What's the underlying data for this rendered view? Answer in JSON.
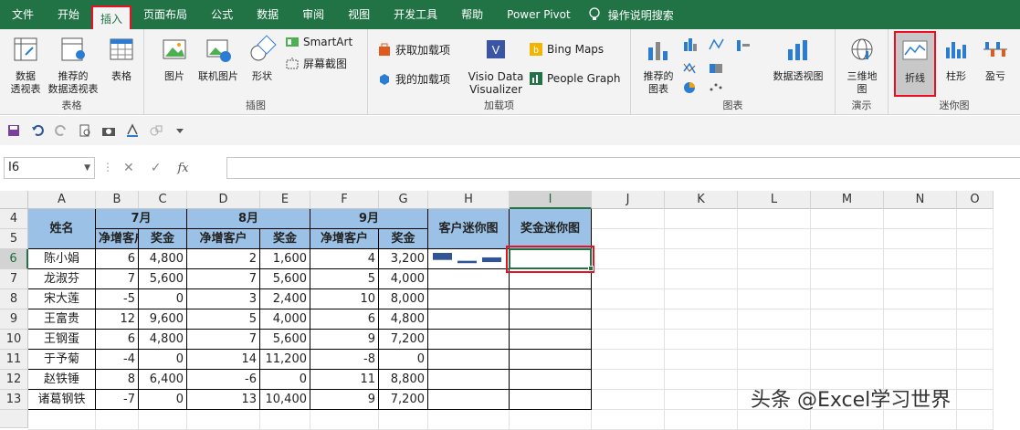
{
  "tabs": [
    {
      "label": "文件",
      "active": false
    },
    {
      "label": "开始",
      "active": false
    },
    {
      "label": "插入",
      "active": true
    },
    {
      "label": "页面布局",
      "active": false
    },
    {
      "label": "公式",
      "active": false
    },
    {
      "label": "数据",
      "active": false
    },
    {
      "label": "审阅",
      "active": false
    },
    {
      "label": "视图",
      "active": false
    },
    {
      "label": "开发工具",
      "active": false
    },
    {
      "label": "帮助",
      "active": false
    },
    {
      "label": "Power Pivot",
      "active": false
    }
  ],
  "tell_me": "操作说明搜索",
  "ribbon": {
    "tables": {
      "label": "表格",
      "pivot": "数据\n透视表",
      "recommended_pivot": "推荐的\n数据透视表",
      "table": "表格"
    },
    "illustrations": {
      "label": "插图",
      "pictures": "图片",
      "online_pictures": "联机图片",
      "shapes": "形状",
      "smartart": "SmartArt",
      "screenshot": "屏幕截图"
    },
    "addins": {
      "label": "加载项",
      "get_addins": "获取加载项",
      "my_addins": "我的加载项",
      "visio": "Visio Data\nVisualizer",
      "bing_maps": "Bing Maps",
      "people_graph": "People Graph"
    },
    "charts": {
      "label": "图表",
      "recommended": "推荐的\n图表",
      "pivot_chart": "数据透视图"
    },
    "tours": {
      "label": "演示",
      "map3d": "三维地\n图"
    },
    "sparklines": {
      "label": "迷你图",
      "line": "折线",
      "column": "柱形",
      "winloss": "盈亏"
    }
  },
  "namebox": "I6",
  "columns": [
    "A",
    "B",
    "C",
    "D",
    "E",
    "F",
    "G",
    "H",
    "I",
    "J",
    "K",
    "L",
    "M",
    "N",
    "O"
  ],
  "selected_column": "I",
  "rows": [
    "4",
    "5",
    "6",
    "7",
    "8",
    "9",
    "10",
    "11",
    "12",
    "13"
  ],
  "selected_row": "6",
  "header": {
    "name": "姓名",
    "jul": "7月",
    "aug": "8月",
    "sep": "9月",
    "cust_spark": "客户迷你图",
    "bonus_spark": "奖金迷你图",
    "net_customers": "净增客户",
    "bonus": "奖金"
  },
  "table": [
    {
      "name": "陈小娟",
      "b": "6",
      "c": "4,800",
      "d": "2",
      "e": "1,600",
      "f": "4",
      "g": "3,200",
      "spark": [
        6,
        2,
        4
      ]
    },
    {
      "name": "龙淑芬",
      "b": "7",
      "c": "5,600",
      "d": "7",
      "e": "5,600",
      "f": "5",
      "g": "4,000"
    },
    {
      "name": "宋大莲",
      "b": "-5",
      "c": "0",
      "d": "3",
      "e": "2,400",
      "f": "10",
      "g": "8,000"
    },
    {
      "name": "王富贵",
      "b": "12",
      "c": "9,600",
      "d": "5",
      "e": "4,000",
      "f": "6",
      "g": "4,800"
    },
    {
      "name": "王钢蛋",
      "b": "6",
      "c": "4,800",
      "d": "7",
      "e": "5,600",
      "f": "9",
      "g": "7,200"
    },
    {
      "name": "于予菊",
      "b": "-4",
      "c": "0",
      "d": "14",
      "e": "11,200",
      "f": "-8",
      "g": "0"
    },
    {
      "name": "赵铁锤",
      "b": "8",
      "c": "6,400",
      "d": "-6",
      "e": "0",
      "f": "11",
      "g": "8,800"
    },
    {
      "name": "诸葛钢铁",
      "b": "-7",
      "c": "0",
      "d": "13",
      "e": "10,400",
      "f": "9",
      "g": "7,200"
    }
  ],
  "watermark": "头条 @Excel学习世界",
  "colors": {
    "ribbon_green": "#217346",
    "header_blue": "#9bc2e6",
    "highlight_red": "#e81123",
    "sparkline": "#2f5597"
  }
}
